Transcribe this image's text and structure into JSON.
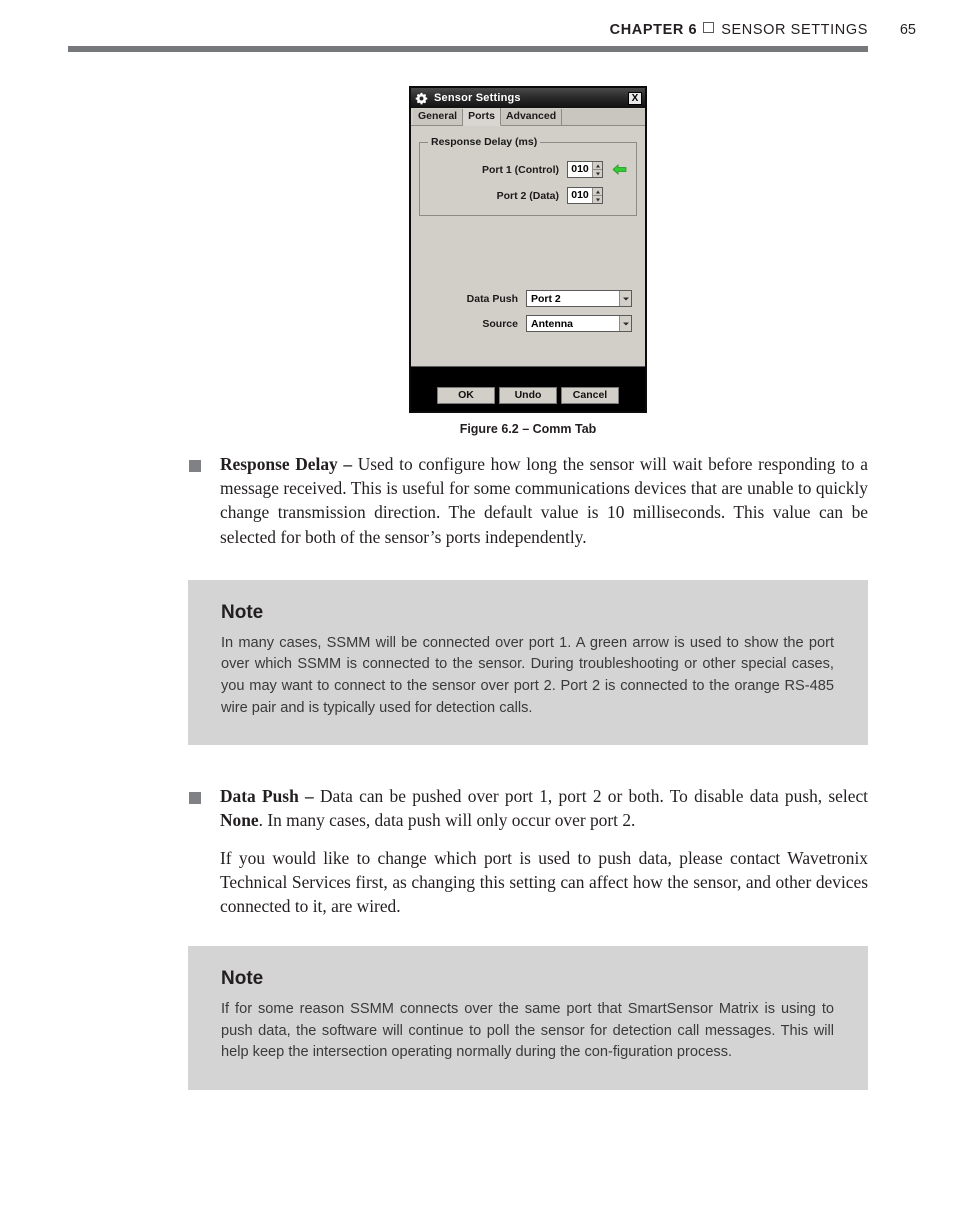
{
  "header": {
    "chapter": "CHAPTER 6",
    "separator_icon": "square-glyph",
    "title": "SENSOR SETTINGS",
    "page_number": "65"
  },
  "figure": {
    "caption": "Figure 6.2 – Comm Tab",
    "dialog": {
      "title": "Sensor Settings",
      "title_icon": "gear-icon",
      "close_label": "X",
      "tabs": [
        {
          "label": "General",
          "active": false
        },
        {
          "label": "Ports",
          "active": true
        },
        {
          "label": "Advanced",
          "active": false
        }
      ],
      "group": {
        "legend": "Response Delay (ms)",
        "rows": [
          {
            "label": "Port 1 (Control)",
            "value": "010",
            "indicator": "green-arrow-left"
          },
          {
            "label": "Port 2 (Data)",
            "value": "010",
            "indicator": ""
          }
        ]
      },
      "combos": [
        {
          "label": "Data Push",
          "value": "Port 2"
        },
        {
          "label": "Source",
          "value": "Antenna"
        }
      ],
      "buttons": [
        {
          "label": "OK"
        },
        {
          "label": "Undo"
        },
        {
          "label": "Cancel"
        }
      ],
      "colors": {
        "panel": "#d2cfc9",
        "titlebar": "#1c1c1c",
        "footer": "#000000",
        "indicator_green": "#33cc33"
      }
    }
  },
  "content": {
    "bullets": [
      {
        "term": "Response Delay – ",
        "text": "Used to configure how long the sensor will wait before responding to a message received. This is useful for some communications devices that are unable to quickly change transmission direction. The default value is 10 milliseconds. This value can be selected for both of the sensor’s ports independently."
      }
    ],
    "note_one": {
      "title": "Note",
      "text": "In many cases, SSMM will be connected over port 1. A green arrow is used to show the port over which SSMM is connected to the sensor. During troubleshooting or other special cases, you may want to connect to the sensor over port 2. Port 2 is connected to the orange RS-485 wire pair and is typically used for detection calls."
    },
    "data_push": {
      "term": "Data Push – ",
      "text_before_bold": "Data can be pushed over port 1, port 2 or both. To disable data push, select ",
      "bold_word": "None",
      "text_after_bold": ". In many cases, data push will only occur over port 2.",
      "paragraph_two": "If you would like to change which port is used to push data, please contact Wavetronix Technical Services first, as changing this setting can affect how the sensor, and other devices connected to it, are wired."
    },
    "note_two": {
      "title": "Note",
      "text": "If for some reason SSMM connects over the same port that SmartSensor Matrix is using to push data, the software will continue to poll the sensor for detection call messages. This will help keep the intersection operating normally during the con-figuration process."
    }
  }
}
